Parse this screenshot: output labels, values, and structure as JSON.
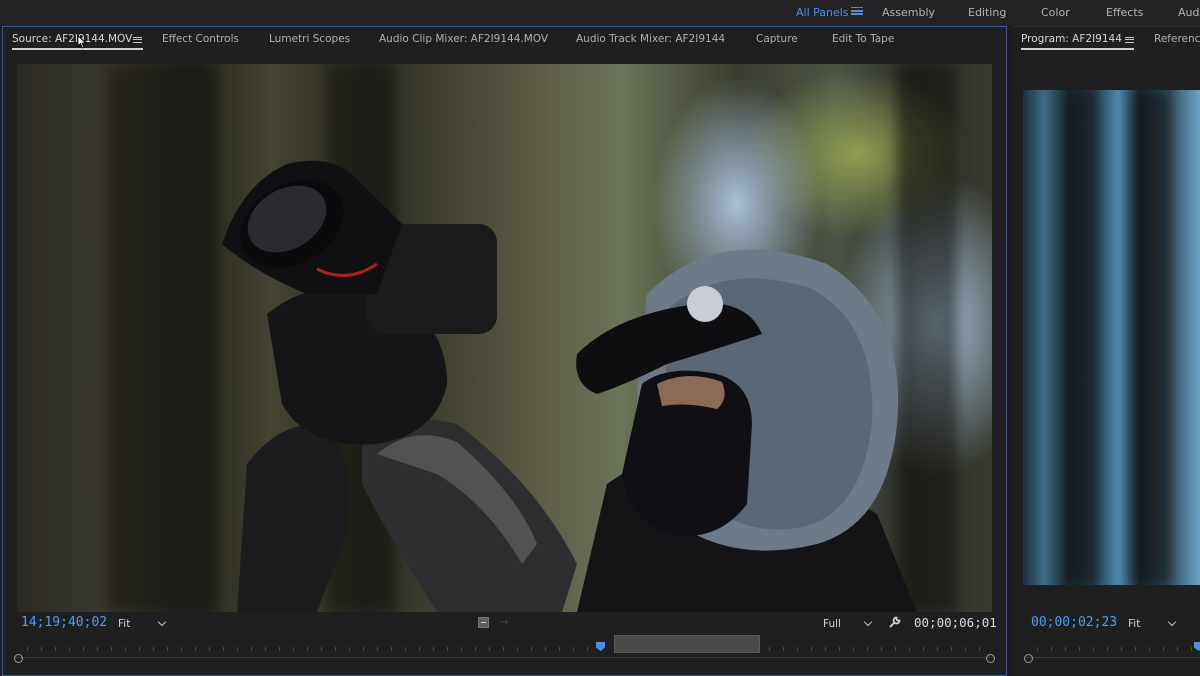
{
  "workspace": {
    "all_panels": "All Panels",
    "items": [
      "Assembly",
      "Editing",
      "Color",
      "Effects",
      "Audi"
    ]
  },
  "source_panel": {
    "tabs": [
      "Source: AF2I9144.MOV",
      "Effect Controls",
      "Lumetri Scopes",
      "Audio Clip Mixer: AF2I9144.MOV",
      "Audio Track Mixer: AF2I9144",
      "Capture",
      "Edit To Tape"
    ],
    "timecode_current": "14;19;40;02",
    "fit_label": "Fit",
    "resolution_label": "Full",
    "timecode_duration": "00;00;06;01"
  },
  "program_panel": {
    "tabs": [
      "Program: AF2I9144",
      "Reference"
    ],
    "timecode_current": "00;00;02;23",
    "fit_label": "Fit"
  },
  "colors": {
    "accent_blue": "#4a8fe3",
    "timecode_blue": "#4a9ff5",
    "panel_bg": "#1f1f1f"
  },
  "icons": [
    "hamburger-menu-icon",
    "chevron-down-icon",
    "wrench-icon",
    "mouse-cursor-icon",
    "playhead-icon",
    "in-point-handle-icon",
    "out-point-handle-icon"
  ]
}
